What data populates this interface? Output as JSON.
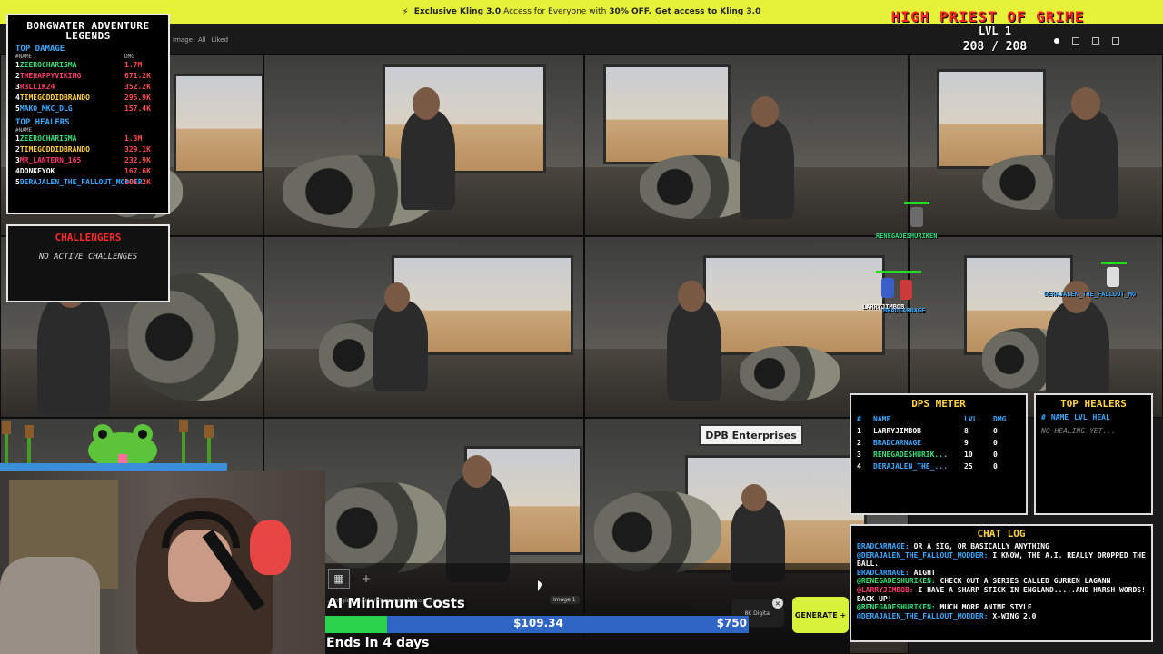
{
  "promo": {
    "prefix": "Exclusive Kling 3.0",
    "middle": "Access for Everyone with",
    "discount": "30% OFF.",
    "cta": "Get access to Kling 3.0",
    "icon": "bolt-icon"
  },
  "breadcrumb": {
    "items": [
      "Image",
      "All",
      "Liked"
    ]
  },
  "tiles": [
    {
      "sign": ""
    },
    {
      "sign": ""
    },
    {
      "sign": ""
    },
    {
      "sign": ""
    },
    {
      "sign": ""
    },
    {
      "sign": ""
    },
    {
      "sign": ""
    },
    {
      "sign": ""
    },
    {
      "sign": "DPB Enterprises"
    }
  ],
  "legends": {
    "title": "BONGWATER ADVENTURE LEGENDS",
    "top_damage_label": "TOP DAMAGE",
    "damage_header": [
      "#NAME",
      "DMG"
    ],
    "top_damage": [
      {
        "rank": "1",
        "name": "ZEEROCHARISMA",
        "value": "1.7M",
        "color": "#33e07a"
      },
      {
        "rank": "2",
        "name": "THEHAPPYVIKING",
        "value": "671.2K",
        "color": "#ff3b6b"
      },
      {
        "rank": "3",
        "name": "R3LLIK24",
        "value": "352.2K",
        "color": "#ff3b6b"
      },
      {
        "rank": "4",
        "name": "TIMEGODDIDBRANDO",
        "value": "295.9K",
        "color": "#ffd23f"
      },
      {
        "rank": "5",
        "name": "MAKO_MKC_DLG",
        "value": "157.4K",
        "color": "#39a9ff"
      }
    ],
    "top_healers_label": "TOP HEALERS",
    "healers_header": [
      "#NAME",
      ""
    ],
    "top_healers": [
      {
        "rank": "1",
        "name": "ZEEROCHARISMA",
        "value": "1.3M",
        "color": "#33e07a"
      },
      {
        "rank": "2",
        "name": "TIMEGODDIDBRANDO",
        "value": "329.1K",
        "color": "#ffd23f"
      },
      {
        "rank": "3",
        "name": "MR_LANTERN_165",
        "value": "232.9K",
        "color": "#ff3b6b"
      },
      {
        "rank": "4",
        "name": "DONKEYOK",
        "value": "167.6K",
        "color": "#ffffff"
      },
      {
        "rank": "5",
        "name": "DERAJALEN_THE_FALLOUT_MODDER",
        "value": "101.2K",
        "color": "#39a9ff"
      }
    ]
  },
  "challengers": {
    "title": "CHALLENGERS",
    "message": "NO ACTIVE CHALLENGES"
  },
  "boss": {
    "title": "HIGH PRIEST OF GRIME",
    "level": "LVL 1",
    "hp": "208 / 208"
  },
  "name_tags": {
    "renegade": "RENEGADESHURIKEN",
    "derajalen": "DERAJALEN_THE_FALLOUT_MO",
    "larry": "LARRYJIMBOB",
    "brad": "BRADCARNAGE"
  },
  "dps": {
    "title": "DPS METER",
    "header": [
      "#",
      "NAME",
      "LVL",
      "DMG"
    ],
    "rows": [
      {
        "rank": "1",
        "name": "LARRYJIMBOB",
        "lvl": "8",
        "dmg": "0",
        "color": "#ffffff"
      },
      {
        "rank": "2",
        "name": "BRADCARNAGE",
        "lvl": "9",
        "dmg": "0",
        "color": "#39a9ff"
      },
      {
        "rank": "3",
        "name": "RENEGADESHURIK...",
        "lvl": "10",
        "dmg": "0",
        "color": "#33e07a"
      },
      {
        "rank": "4",
        "name": "DERAJALEN_THE_...",
        "lvl": "25",
        "dmg": "0",
        "color": "#39a9ff"
      }
    ]
  },
  "healers_panel": {
    "title": "TOP HEALERS",
    "header": [
      "#",
      "NAME",
      "LVL",
      "HEAL"
    ],
    "message": "NO HEALING YET..."
  },
  "chat": {
    "title": "CHAT LOG",
    "lines": [
      {
        "user": "BRADCARNAGE:",
        "text": "OR A SIG, OR BASICALLY ANYTHING",
        "cls": "u1"
      },
      {
        "user": "@DERAJALEN_THE_FALLOUT_MODDER:",
        "text": "I KNOW, THE A.I. REALLY DROPPED THE BALL.",
        "cls": "u4"
      },
      {
        "user": "BRADCARNAGE:",
        "text": "AIGHT",
        "cls": "u1"
      },
      {
        "user": "@RENEGADESHURIKEN:",
        "text": "CHECK OUT A SERIES CALLED GURREN LAGANN",
        "cls": "u3"
      },
      {
        "user": "@LARRYJIMBOB:",
        "text": "I HAVE A SHARP STICK IN ENGLAND.....AND HARSH WORDS! BACK UP!",
        "cls": "u2"
      },
      {
        "user": "@RENEGADESHURIKEN:",
        "text": "MUCH MORE ANIME STYLE",
        "cls": "u3"
      },
      {
        "user": "@DERAJALEN_THE_FALLOUT_MODDER:",
        "text": "X-WING 2.0",
        "cls": "u4"
      }
    ]
  },
  "generator": {
    "prompt": "...engine part in the warehouse in",
    "image_chip": "Image 1",
    "options": "8K Digital",
    "button": "GENERATE +",
    "thumb_icon": "image-thumb-icon"
  },
  "goal": {
    "title": "AI Minimum Costs",
    "current": "$109.34",
    "target": "$750",
    "progress": 0.146,
    "ends": "Ends in 4 days"
  }
}
